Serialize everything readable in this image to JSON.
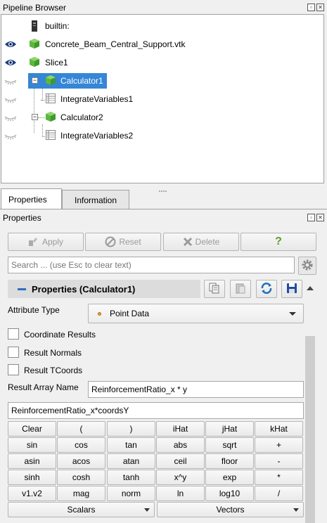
{
  "pipeline_panel": {
    "title": "Pipeline Browser",
    "items": [
      {
        "label": "builtin:",
        "icon": "server-icon",
        "eye": "none",
        "selected": false
      },
      {
        "label": "Concrete_Beam_Central_Support.vtk",
        "icon": "source-cube-icon",
        "eye": "visible",
        "selected": false
      },
      {
        "label": "Slice1",
        "icon": "filter-cube-icon",
        "eye": "visible",
        "selected": false
      },
      {
        "label": "Calculator1",
        "icon": "filter-cube-icon",
        "eye": "hidden",
        "selected": true
      },
      {
        "label": "IntegrateVariables1",
        "icon": "table-icon",
        "eye": "hidden",
        "selected": false
      },
      {
        "label": "Calculator2",
        "icon": "filter-cube-icon",
        "eye": "hidden",
        "selected": false
      },
      {
        "label": "IntegrateVariables2",
        "icon": "table-icon",
        "eye": "hidden",
        "selected": false
      }
    ]
  },
  "tabs": {
    "properties": "Properties",
    "information": "Information"
  },
  "properties_panel": {
    "title": "Properties",
    "apply": "Apply",
    "reset": "Reset",
    "delete": "Delete",
    "help": "?",
    "search_placeholder": "Search ... (use Esc to clear text)",
    "section_title": "Properties (Calculator1)",
    "attribute_type_label": "Attribute Type",
    "attribute_type_value": "Point Data",
    "coordinate_results": "Coordinate Results",
    "result_normals": "Result Normals",
    "result_tcoords": "Result TCoords",
    "result_array_name_label": "Result Array Name",
    "result_array_name_value": "ReinforcementRatio_x * y",
    "expression": "ReinforcementRatio_x*coordsY"
  },
  "keypad": {
    "row1": [
      "Clear",
      "(",
      ")",
      "iHat",
      "jHat",
      "kHat"
    ],
    "row2": [
      "sin",
      "cos",
      "tan",
      "abs",
      "sqrt",
      "+"
    ],
    "row3": [
      "asin",
      "acos",
      "atan",
      "ceil",
      "floor",
      "-"
    ],
    "row4": [
      "sinh",
      "cosh",
      "tanh",
      "x^y",
      "exp",
      "*"
    ],
    "row5": [
      "v1.v2",
      "mag",
      "norm",
      "ln",
      "log10",
      "/"
    ],
    "scalars": "Scalars",
    "vectors": "Vectors"
  },
  "colors": {
    "selection": "#3586d6",
    "accent_blue": "#2d6fc2",
    "cube_green": "#4caf32"
  }
}
